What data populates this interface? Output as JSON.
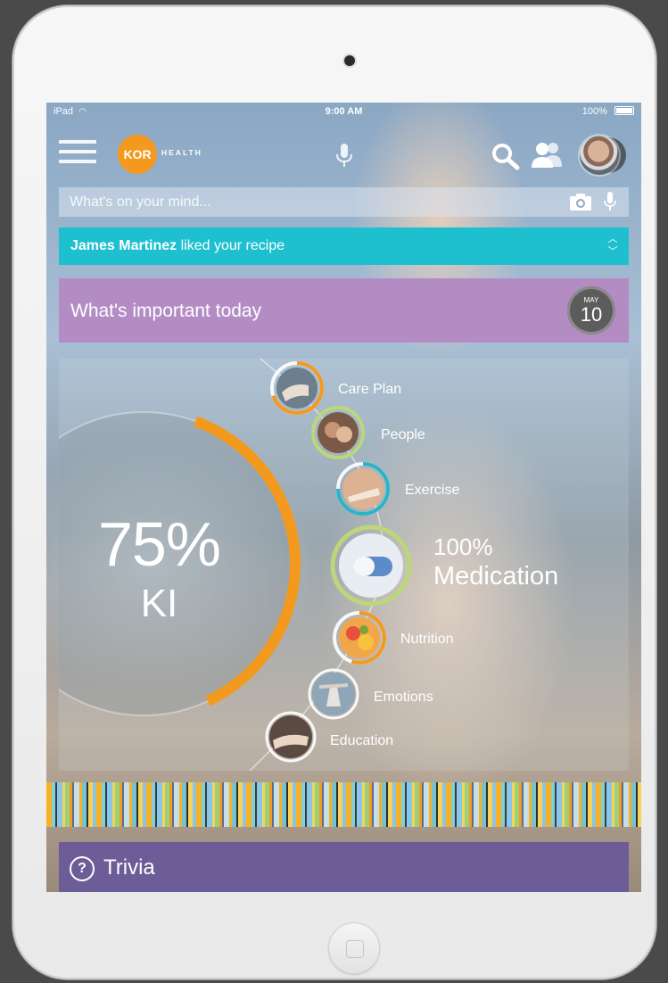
{
  "status_bar": {
    "device": "iPad",
    "time": "9:00 AM",
    "battery": "100%"
  },
  "header": {
    "logo_badge": "KOR",
    "logo_text": "HEALTH"
  },
  "composer": {
    "placeholder": "What's on your mind..."
  },
  "notification": {
    "name": "James Martinez",
    "action": "liked your recipe"
  },
  "today": {
    "title": "What's important today",
    "month": "MAY",
    "day": "10"
  },
  "score": {
    "percent": "75%",
    "label": "KI",
    "value": 0.75
  },
  "categories": [
    {
      "label": "Care Plan",
      "progress": 0.7
    },
    {
      "label": "People",
      "progress": 1.0
    },
    {
      "label": "Exercise",
      "progress": 0.75
    },
    {
      "label": "Medication",
      "progress": 1.0,
      "percent": "100%"
    },
    {
      "label": "Nutrition",
      "progress": 0.55
    },
    {
      "label": "Emotions",
      "progress": 0.0
    },
    {
      "label": "Education",
      "progress": 0.0
    }
  ],
  "trivia": {
    "icon_text": "?",
    "label": "Trivia"
  },
  "colors": {
    "accent_orange": "#f39a1e",
    "teal": "#1ec0d0",
    "purple": "#b48cc4",
    "trivia_purple": "#6c5c97",
    "ring_green": "#bcd77a",
    "ring_teal": "#2ab4c8"
  }
}
